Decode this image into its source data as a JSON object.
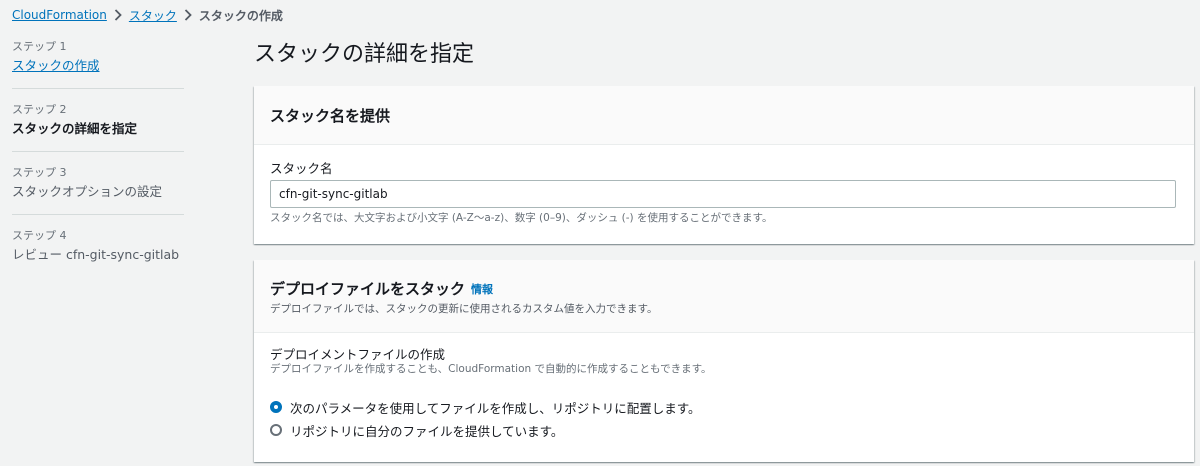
{
  "breadcrumb": {
    "items": [
      "CloudFormation",
      "スタック"
    ],
    "current": "スタックの作成"
  },
  "steps": [
    {
      "number": "ステップ 1",
      "title": "スタックの作成",
      "state": "link"
    },
    {
      "number": "ステップ 2",
      "title": "スタックの詳細を指定",
      "state": "active"
    },
    {
      "number": "ステップ 3",
      "title": "スタックオプションの設定",
      "state": "disabled"
    },
    {
      "number": "ステップ 4",
      "title": "レビュー cfn-git-sync-gitlab",
      "state": "disabled"
    }
  ],
  "page": {
    "title": "スタックの詳細を指定"
  },
  "stack_name_panel": {
    "header": "スタック名を提供",
    "field_label": "スタック名",
    "field_value": "cfn-git-sync-gitlab",
    "constraint": "スタック名では、大文字および小文字 (A-Z～a-z)、数字 (0–9)、ダッシュ (-) を使用することができます。"
  },
  "deploy_panel": {
    "header": "デプロイファイルをスタック",
    "info_link": "情報",
    "description": "デプロイファイルでは、スタックの更新に使用されるカスタム値を入力できます。",
    "field_label": "デプロイメントファイルの作成",
    "field_description": "デプロイファイルを作成することも、CloudFormation で自動的に作成することもできます。",
    "options": [
      {
        "label": "次のパラメータを使用してファイルを作成し、リポジトリに配置します。",
        "selected": true
      },
      {
        "label": "リポジトリに自分のファイルを提供しています。",
        "selected": false
      }
    ]
  },
  "colors": {
    "link": "#0073bb",
    "background": "#f2f3f3",
    "panel": "#ffffff",
    "panel_header": "#fafafa",
    "text": "#16191f",
    "muted": "#687078"
  },
  "icons": {
    "breadcrumb_separator": "chevron-right-icon"
  }
}
